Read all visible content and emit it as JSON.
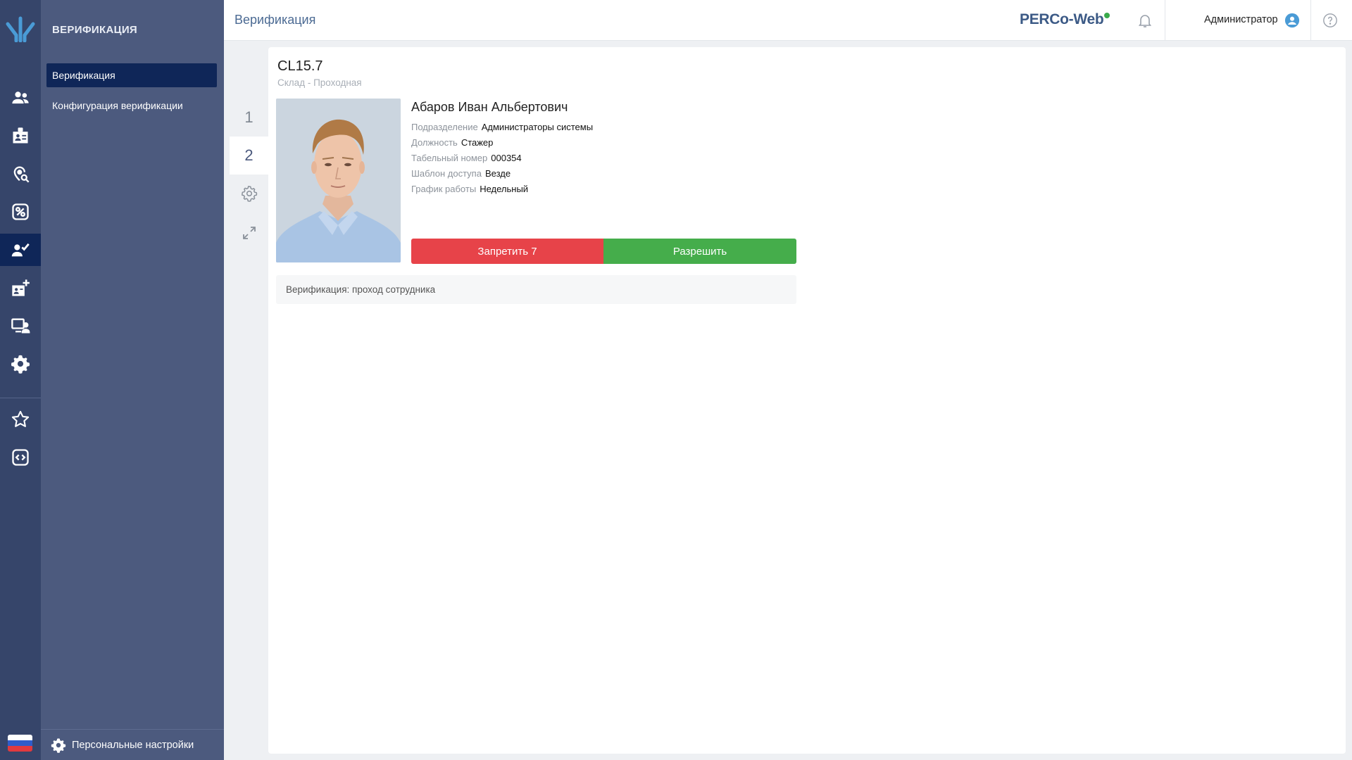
{
  "sidebar": {
    "title": "ВЕРИФИКАЦИЯ",
    "items": [
      {
        "label": "Верификация"
      },
      {
        "label": "Конфигурация верификации"
      }
    ],
    "personal_settings": "Персональные настройки"
  },
  "header": {
    "page_title": "Верификация",
    "brand": "PERCo-Web",
    "user": "Администратор"
  },
  "tabs": [
    "1",
    "2"
  ],
  "device": {
    "name": "CL15.7",
    "location": "Склад - Проходная"
  },
  "employee": {
    "name": "Абаров Иван Альбертович",
    "fields": [
      {
        "label": "Подразделение",
        "value": "Администраторы системы"
      },
      {
        "label": "Должность",
        "value": "Стажер"
      },
      {
        "label": "Табельный номер",
        "value": "000354"
      },
      {
        "label": "Шаблон доступа",
        "value": "Везде"
      },
      {
        "label": "График работы",
        "value": "Недельный"
      }
    ]
  },
  "actions": {
    "deny_label": "Запретить 7",
    "allow_label": "Разрешить"
  },
  "event_text": "Верификация: проход сотрудника",
  "colors": {
    "rail": "#36456a",
    "sidebar": "#4c5a7e",
    "active": "#0f2658",
    "deny": "#e74349",
    "allow": "#45ad4b",
    "brand": "#3c5a86"
  },
  "icons": {
    "rail": [
      "employees-icon",
      "id-card-icon",
      "location-search-icon",
      "key-route-icon",
      "verification-icon",
      "id-card-add-icon",
      "monitor-user-icon",
      "gear-icon",
      "star-icon",
      "code-icon"
    ]
  }
}
